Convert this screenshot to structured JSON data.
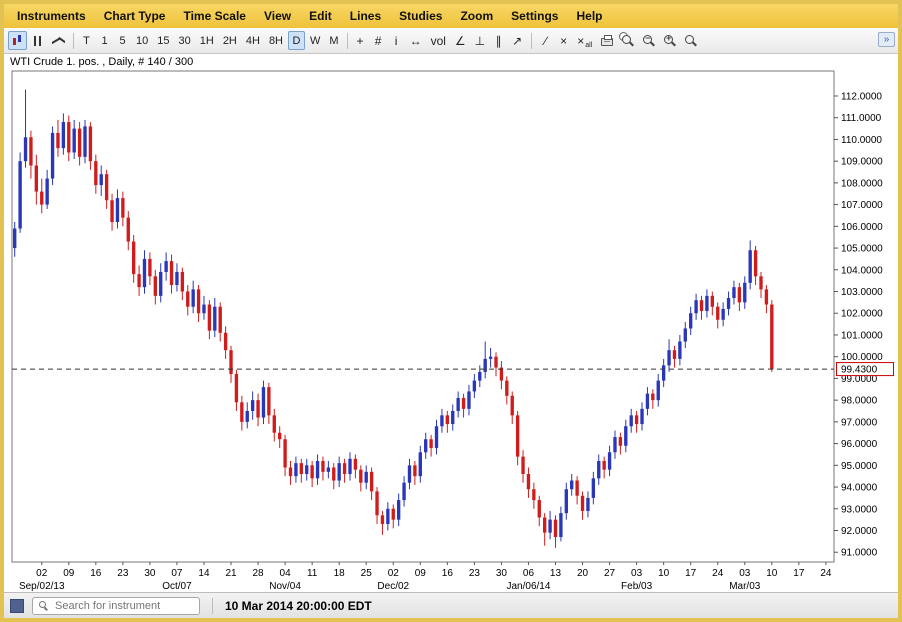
{
  "menu": {
    "items": [
      "Instruments",
      "Chart Type",
      "Time Scale",
      "View",
      "Edit",
      "Lines",
      "Studies",
      "Zoom",
      "Settings",
      "Help"
    ]
  },
  "toolbar": {
    "chart_type": [
      {
        "name": "candlestick-chart-icon",
        "style": "candle",
        "selected": true
      },
      {
        "name": "ohlc-bars-icon",
        "style": "bars",
        "selected": false
      },
      {
        "name": "line-chart-icon",
        "style": "line",
        "selected": false
      }
    ],
    "timescales": [
      "T",
      "1",
      "5",
      "10",
      "15",
      "30",
      "1H",
      "2H",
      "4H",
      "8H",
      "D",
      "W",
      "M"
    ],
    "selected_timescale": "D",
    "tools": [
      {
        "name": "crosshair-icon",
        "glyph": "+"
      },
      {
        "name": "grid-icon",
        "glyph": "#"
      },
      {
        "name": "info-icon",
        "glyph": "i"
      },
      {
        "name": "expand-horizontal-icon",
        "glyph": "↔"
      },
      {
        "name": "volume-icon",
        "glyph": "vol"
      },
      {
        "name": "trend-line-icon",
        "glyph": "∠"
      },
      {
        "name": "vertical-line-icon",
        "glyph": "⊥"
      },
      {
        "name": "parallel-lines-icon",
        "glyph": "∥"
      },
      {
        "name": "ray-line-icon",
        "glyph": "↗"
      },
      {
        "sep": true
      },
      {
        "name": "freehand-line-icon",
        "glyph": "∕"
      },
      {
        "name": "delete-line-icon",
        "glyph": "×"
      },
      {
        "name": "delete-all-lines-icon",
        "glyph": "×",
        "sub": "all"
      },
      {
        "name": "printer-icon",
        "css": "print"
      },
      {
        "name": "print-preview-icon",
        "css": "magdoc"
      },
      {
        "name": "zoom-out-icon",
        "css": "magm"
      },
      {
        "name": "zoom-in-icon",
        "css": "magp"
      },
      {
        "name": "zoom-range-icon",
        "css": "magfit"
      }
    ],
    "collapse_glyph": "»"
  },
  "chart": {
    "title": "WTI Crude 1. pos. , Daily, # 140 / 300"
  },
  "chart_data": {
    "type": "candlestick",
    "instrument": "WTI Crude 1. pos.",
    "timeframe": "Daily",
    "bar_counter": "# 140 / 300",
    "ylim": [
      90.55,
      113.15
    ],
    "y_ticks": [
      91,
      92,
      93,
      94,
      95,
      96,
      97,
      98,
      99,
      100,
      101,
      102,
      103,
      104,
      105,
      106,
      107,
      108,
      109,
      110,
      111,
      112
    ],
    "slot_count": 152,
    "day_label_start_slot": 5,
    "day_label_step": 5,
    "day_labels": [
      "02",
      "09",
      "16",
      "23",
      "30",
      "07",
      "14",
      "21",
      "28",
      "04",
      "11",
      "18",
      "25",
      "02",
      "09",
      "16",
      "23",
      "30",
      "06",
      "13",
      "20",
      "27",
      "03",
      "10",
      "17",
      "24",
      "03",
      "10",
      "17",
      "24"
    ],
    "month_labels": [
      {
        "slot": 5,
        "label": "Sep/02/13"
      },
      {
        "slot": 30,
        "label": "Oct/07"
      },
      {
        "slot": 50,
        "label": "Nov/04"
      },
      {
        "slot": 70,
        "label": "Dec/02"
      },
      {
        "slot": 95,
        "label": "Jan/06/14"
      },
      {
        "slot": 115,
        "label": "Feb/03"
      },
      {
        "slot": 135,
        "label": "Mar/03"
      }
    ],
    "last_price": 99.43,
    "last_price_label": "99.4300",
    "colors": {
      "up": "#2937b8",
      "down": "#cf1d1d",
      "dashed": "#333333",
      "tag_border": "#cc0000"
    },
    "ohlc": [
      [
        105.0,
        106.2,
        104.6,
        105.9
      ],
      [
        105.9,
        109.4,
        105.7,
        109.0
      ],
      [
        109.0,
        112.3,
        108.7,
        110.1
      ],
      [
        110.1,
        110.4,
        108.2,
        108.8
      ],
      [
        108.8,
        109.3,
        107.0,
        107.6
      ],
      [
        107.6,
        108.2,
        106.6,
        107.0
      ],
      [
        107.0,
        108.6,
        106.8,
        108.2
      ],
      [
        108.2,
        110.6,
        107.9,
        110.3
      ],
      [
        110.3,
        110.9,
        109.2,
        109.6
      ],
      [
        109.6,
        111.2,
        109.3,
        110.8
      ],
      [
        110.8,
        111.1,
        109.0,
        109.4
      ],
      [
        109.4,
        110.9,
        109.1,
        110.5
      ],
      [
        110.5,
        110.8,
        108.8,
        109.2
      ],
      [
        109.2,
        110.9,
        108.9,
        110.6
      ],
      [
        110.6,
        110.8,
        108.6,
        109.0
      ],
      [
        109.0,
        109.3,
        107.5,
        107.9
      ],
      [
        107.9,
        108.8,
        107.4,
        108.4
      ],
      [
        108.4,
        108.6,
        106.8,
        107.2
      ],
      [
        107.2,
        107.5,
        105.8,
        106.2
      ],
      [
        106.2,
        107.7,
        105.9,
        107.3
      ],
      [
        107.3,
        107.6,
        106.0,
        106.4
      ],
      [
        106.4,
        106.7,
        104.9,
        105.3
      ],
      [
        105.3,
        105.6,
        103.4,
        103.8
      ],
      [
        103.8,
        104.2,
        102.8,
        103.2
      ],
      [
        103.2,
        104.9,
        102.9,
        104.5
      ],
      [
        104.5,
        104.8,
        103.3,
        103.7
      ],
      [
        103.7,
        104.0,
        102.4,
        102.8
      ],
      [
        102.8,
        104.3,
        102.5,
        103.9
      ],
      [
        103.9,
        104.8,
        103.5,
        104.4
      ],
      [
        104.4,
        104.7,
        102.9,
        103.3
      ],
      [
        103.3,
        104.3,
        103.0,
        103.9
      ],
      [
        103.9,
        104.1,
        102.6,
        103.0
      ],
      [
        103.0,
        103.3,
        101.9,
        102.3
      ],
      [
        102.3,
        103.5,
        102.0,
        103.1
      ],
      [
        103.1,
        103.3,
        101.6,
        102.0
      ],
      [
        102.0,
        102.8,
        101.7,
        102.4
      ],
      [
        102.4,
        102.6,
        100.8,
        101.2
      ],
      [
        101.2,
        102.7,
        100.9,
        102.3
      ],
      [
        102.3,
        102.5,
        100.7,
        101.1
      ],
      [
        101.1,
        101.4,
        99.9,
        100.3
      ],
      [
        100.3,
        100.5,
        98.8,
        99.2
      ],
      [
        99.2,
        99.4,
        97.5,
        97.9
      ],
      [
        97.9,
        98.2,
        96.6,
        97.0
      ],
      [
        97.0,
        97.9,
        96.7,
        97.5
      ],
      [
        97.5,
        98.4,
        97.1,
        98.0
      ],
      [
        98.0,
        98.3,
        96.8,
        97.2
      ],
      [
        97.2,
        98.9,
        96.9,
        98.6
      ],
      [
        98.6,
        98.8,
        96.9,
        97.3
      ],
      [
        97.3,
        97.6,
        96.1,
        96.5
      ],
      [
        96.5,
        96.8,
        95.8,
        96.2
      ],
      [
        96.2,
        96.4,
        94.5,
        94.9
      ],
      [
        94.9,
        95.2,
        94.1,
        94.5
      ],
      [
        94.5,
        95.4,
        94.2,
        95.1
      ],
      [
        95.1,
        95.3,
        94.2,
        94.6
      ],
      [
        94.6,
        95.3,
        94.3,
        95.0
      ],
      [
        95.0,
        95.2,
        94.0,
        94.4
      ],
      [
        94.4,
        95.5,
        94.1,
        95.2
      ],
      [
        95.2,
        95.4,
        94.3,
        94.7
      ],
      [
        94.7,
        95.2,
        94.4,
        94.9
      ],
      [
        94.9,
        95.1,
        93.9,
        94.3
      ],
      [
        94.3,
        95.4,
        94.0,
        95.1
      ],
      [
        95.1,
        95.3,
        94.2,
        94.6
      ],
      [
        94.6,
        95.6,
        94.3,
        95.3
      ],
      [
        95.3,
        95.5,
        94.4,
        94.8
      ],
      [
        94.8,
        95.0,
        93.8,
        94.2
      ],
      [
        94.2,
        95.0,
        93.9,
        94.7
      ],
      [
        94.7,
        94.9,
        93.4,
        93.8
      ],
      [
        93.8,
        94.0,
        92.3,
        92.7
      ],
      [
        92.7,
        92.9,
        91.8,
        92.3
      ],
      [
        92.3,
        93.3,
        92.0,
        93.0
      ],
      [
        93.0,
        93.2,
        92.1,
        92.5
      ],
      [
        92.5,
        93.7,
        92.2,
        93.4
      ],
      [
        93.4,
        94.5,
        93.1,
        94.2
      ],
      [
        94.2,
        95.3,
        93.9,
        95.0
      ],
      [
        95.0,
        95.2,
        94.1,
        94.5
      ],
      [
        94.5,
        95.9,
        94.2,
        95.6
      ],
      [
        95.6,
        96.5,
        95.3,
        96.2
      ],
      [
        96.2,
        96.4,
        95.4,
        95.8
      ],
      [
        95.8,
        97.1,
        95.5,
        96.8
      ],
      [
        96.8,
        97.6,
        96.5,
        97.3
      ],
      [
        97.3,
        97.5,
        96.5,
        96.9
      ],
      [
        96.9,
        97.8,
        96.6,
        97.5
      ],
      [
        97.5,
        98.4,
        97.2,
        98.1
      ],
      [
        98.1,
        98.3,
        97.2,
        97.6
      ],
      [
        97.6,
        98.7,
        97.3,
        98.4
      ],
      [
        98.4,
        99.2,
        98.1,
        98.9
      ],
      [
        98.9,
        99.6,
        98.6,
        99.3
      ],
      [
        99.3,
        100.7,
        99.0,
        99.9
      ],
      [
        99.9,
        100.4,
        99.5,
        100.0
      ],
      [
        100.0,
        100.2,
        99.1,
        99.5
      ],
      [
        99.5,
        99.8,
        98.5,
        98.9
      ],
      [
        98.9,
        99.1,
        97.8,
        98.2
      ],
      [
        98.2,
        98.4,
        96.9,
        97.3
      ],
      [
        97.3,
        97.5,
        95.0,
        95.4
      ],
      [
        95.4,
        95.7,
        94.2,
        94.6
      ],
      [
        94.6,
        94.9,
        93.5,
        93.9
      ],
      [
        93.9,
        94.2,
        93.0,
        93.4
      ],
      [
        93.4,
        93.6,
        92.2,
        92.6
      ],
      [
        92.6,
        92.8,
        91.3,
        91.9
      ],
      [
        91.9,
        92.9,
        91.6,
        92.5
      ],
      [
        92.5,
        92.7,
        91.2,
        91.7
      ],
      [
        91.7,
        93.1,
        91.5,
        92.8
      ],
      [
        92.8,
        94.2,
        92.5,
        93.9
      ],
      [
        93.9,
        94.6,
        93.6,
        94.3
      ],
      [
        94.3,
        94.5,
        93.2,
        93.6
      ],
      [
        93.6,
        93.8,
        92.5,
        92.9
      ],
      [
        92.9,
        93.8,
        92.6,
        93.5
      ],
      [
        93.5,
        94.7,
        93.2,
        94.4
      ],
      [
        94.4,
        95.5,
        94.1,
        95.2
      ],
      [
        95.2,
        95.4,
        94.4,
        94.8
      ],
      [
        94.8,
        95.9,
        94.5,
        95.6
      ],
      [
        95.6,
        96.6,
        95.3,
        96.3
      ],
      [
        96.3,
        96.5,
        95.5,
        95.9
      ],
      [
        95.9,
        97.1,
        95.6,
        96.8
      ],
      [
        96.8,
        97.6,
        96.5,
        97.3
      ],
      [
        97.3,
        97.5,
        96.5,
        96.9
      ],
      [
        96.9,
        97.9,
        96.6,
        97.6
      ],
      [
        97.6,
        98.6,
        97.3,
        98.3
      ],
      [
        98.3,
        98.5,
        97.6,
        98.0
      ],
      [
        98.0,
        99.2,
        97.7,
        98.9
      ],
      [
        98.9,
        99.9,
        98.6,
        99.6
      ],
      [
        99.6,
        100.8,
        99.3,
        100.3
      ],
      [
        100.3,
        100.5,
        99.5,
        99.9
      ],
      [
        99.9,
        101.0,
        99.6,
        100.7
      ],
      [
        100.7,
        101.6,
        100.4,
        101.3
      ],
      [
        101.3,
        102.3,
        101.0,
        102.0
      ],
      [
        102.0,
        102.9,
        101.7,
        102.6
      ],
      [
        102.6,
        102.8,
        101.7,
        102.1
      ],
      [
        102.1,
        103.1,
        101.8,
        102.8
      ],
      [
        102.8,
        103.0,
        101.9,
        102.3
      ],
      [
        102.3,
        102.5,
        101.3,
        101.7
      ],
      [
        101.7,
        102.5,
        101.4,
        102.2
      ],
      [
        102.2,
        103.0,
        101.9,
        102.7
      ],
      [
        102.7,
        103.5,
        102.4,
        103.2
      ],
      [
        103.2,
        103.4,
        102.1,
        102.5
      ],
      [
        102.5,
        103.7,
        102.2,
        103.4
      ],
      [
        103.4,
        105.35,
        103.1,
        104.9
      ],
      [
        104.9,
        105.1,
        103.3,
        103.7
      ],
      [
        103.7,
        103.9,
        102.7,
        103.1
      ],
      [
        103.1,
        103.3,
        102.0,
        102.4
      ],
      [
        102.4,
        102.6,
        99.3,
        99.43
      ]
    ]
  },
  "statusbar": {
    "search_placeholder": "Search for instrument",
    "timestamp": "10 Mar 2014 20:00:00 EDT"
  }
}
